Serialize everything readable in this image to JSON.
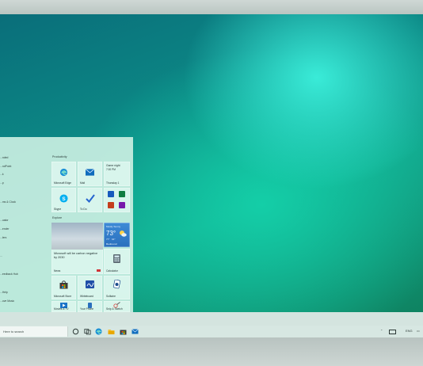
{
  "start_menu": {
    "app_list": [
      "...nded",
      "...ndPoint",
      "...k",
      "...p",
      "...ms & Clock",
      "...uator",
      "...ender",
      "...lers",
      "...",
      "...eedback Hub",
      "...Help",
      "...ove Music"
    ],
    "groups": {
      "productivity": "Productivity",
      "explore": "Explore"
    },
    "tiles": {
      "edge": "Microsoft Edge",
      "mail": "Mail",
      "calendar_event": "Game night",
      "calendar_time": "7:00 PM",
      "calendar_date": "Thursday 1",
      "skype": "Skype",
      "todo": "To Do",
      "weather_condition": "Mostly Sunny",
      "weather_temp": "73°",
      "weather_hi": "77°",
      "weather_lo": "64°",
      "weather_city": "Redmond",
      "news_headline": "Microsoft will be carbon negative by 2030",
      "news": "News",
      "calculator": "Calculator",
      "store": "Microsoft Store",
      "whiteboard": "Whiteboard",
      "solitaire": "Solitaire",
      "movies": "Movies & TV",
      "phone": "Your Phone",
      "snip": "Snip & Sketch"
    }
  },
  "taskbar": {
    "search_placeholder": "Here to search",
    "tray": {
      "lang": "ENG",
      "icons": [
        "chevron-up-icon",
        "battery-icon",
        "network-icon",
        "volume-icon",
        "notification-icon"
      ]
    }
  },
  "colors": {
    "accent": "#0078d4",
    "menu_bg": "#c8eee1",
    "taskbar_bg": "#d4e4df"
  }
}
